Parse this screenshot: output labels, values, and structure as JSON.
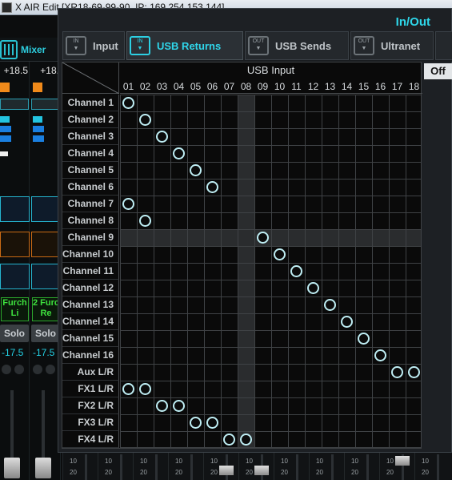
{
  "window": {
    "title": "X AIR Edit [XR18-69-99-90, IP: 169.254.153.144]"
  },
  "mixer": {
    "tab_label": "Mixer",
    "channels": [
      {
        "gain": "+18.5",
        "name": "Furch Li",
        "solo": "Solo",
        "fader_db": "-17.5"
      },
      {
        "gain": "+18.",
        "name": "2 Furc Re",
        "solo": "Solo",
        "fader_db": "-17.5"
      }
    ]
  },
  "inout": {
    "title": "In/Out",
    "tabs": [
      {
        "label": "Input",
        "icon": "in-arrow-icon",
        "icon_text": "IN"
      },
      {
        "label": "USB Returns",
        "icon": "in-arrow-icon",
        "icon_text": "IN"
      },
      {
        "label": "USB Sends",
        "icon": "out-arrow-icon",
        "icon_text": "OUT"
      },
      {
        "label": "Ultranet",
        "icon": "out-arrow-icon",
        "icon_text": "OUT"
      }
    ],
    "active_tab": "USB Returns"
  },
  "off_button": "Off",
  "grid": {
    "column_group_label": "USB Input",
    "columns": [
      "01",
      "02",
      "03",
      "04",
      "05",
      "06",
      "07",
      "08",
      "09",
      "10",
      "11",
      "12",
      "13",
      "14",
      "15",
      "16",
      "17",
      "18"
    ],
    "rows": [
      "Channel 1",
      "Channel 2",
      "Channel 3",
      "Channel 4",
      "Channel 5",
      "Channel 6",
      "Channel 7",
      "Channel 8",
      "Channel 9",
      "Channel 10",
      "Channel 11",
      "Channel 12",
      "Channel 13",
      "Channel 14",
      "Channel 15",
      "Channel 16",
      "Aux L/R",
      "FX1 L/R",
      "FX2 L/R",
      "FX3 L/R",
      "FX4 L/R"
    ],
    "highlight_row": "Channel 9",
    "highlight_column": "08",
    "routes": [
      [
        "Channel 1",
        "01"
      ],
      [
        "Channel 2",
        "02"
      ],
      [
        "Channel 3",
        "03"
      ],
      [
        "Channel 4",
        "04"
      ],
      [
        "Channel 5",
        "05"
      ],
      [
        "Channel 6",
        "06"
      ],
      [
        "Channel 7",
        "01"
      ],
      [
        "Channel 8",
        "02"
      ],
      [
        "Channel 9",
        "09"
      ],
      [
        "Channel 10",
        "10"
      ],
      [
        "Channel 11",
        "11"
      ],
      [
        "Channel 12",
        "12"
      ],
      [
        "Channel 13",
        "13"
      ],
      [
        "Channel 14",
        "14"
      ],
      [
        "Channel 15",
        "15"
      ],
      [
        "Channel 16",
        "16"
      ],
      [
        "Aux L/R",
        "17"
      ],
      [
        "Aux L/R",
        "18"
      ],
      [
        "FX1 L/R",
        "01"
      ],
      [
        "FX1 L/R",
        "02"
      ],
      [
        "FX2 L/R",
        "03"
      ],
      [
        "FX2 L/R",
        "04"
      ],
      [
        "FX3 L/R",
        "05"
      ],
      [
        "FX3 L/R",
        "06"
      ],
      [
        "FX4 L/R",
        "07"
      ],
      [
        "FX4 L/R",
        "08"
      ]
    ]
  },
  "bottom_faders": {
    "scale_marks": [
      "10",
      "20"
    ]
  },
  "colors": {
    "accent": "#2ed7ea",
    "route_ring": "#bfeef4",
    "name_green": "#3ee03e"
  }
}
